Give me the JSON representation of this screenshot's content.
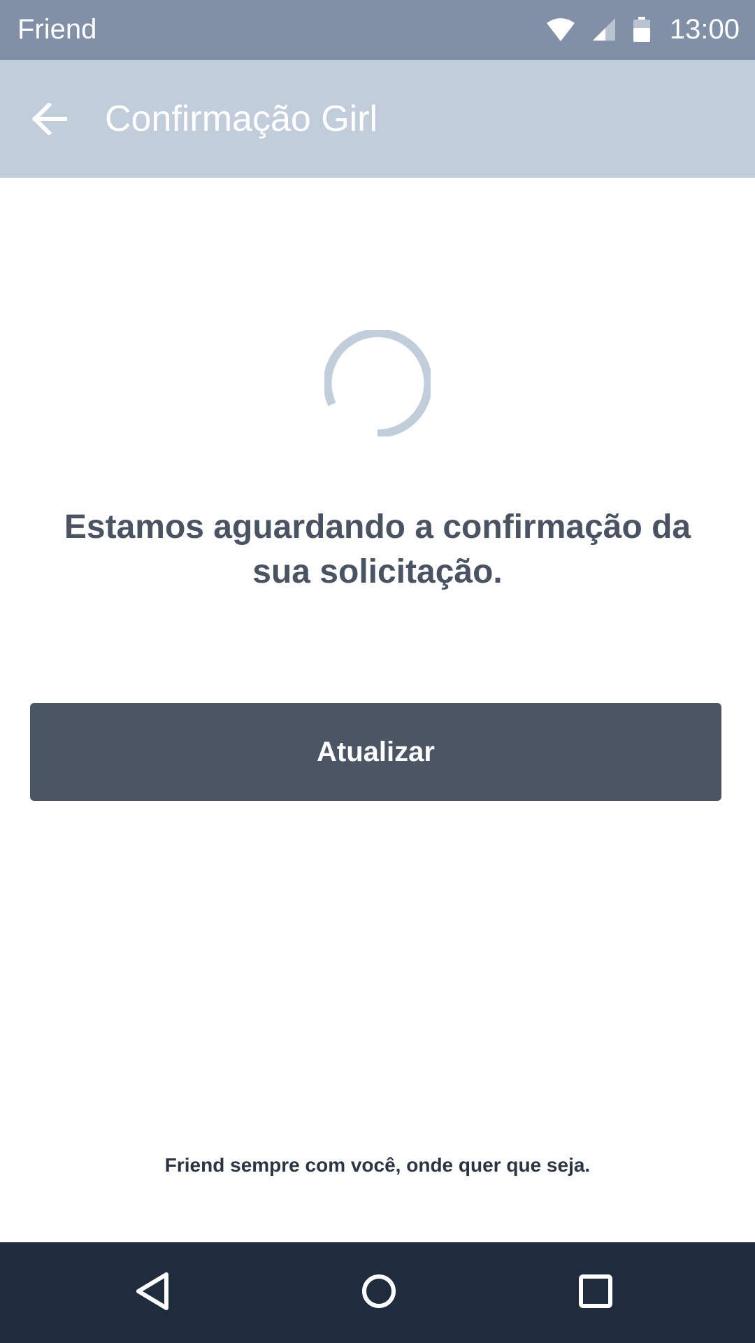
{
  "status_bar": {
    "carrier": "Friend",
    "time": "13:00",
    "icons": [
      "wifi-icon",
      "cell-signal-icon",
      "battery-icon"
    ]
  },
  "app_bar": {
    "title": "Confirmação Girl",
    "back_icon": "arrow-left-icon"
  },
  "main": {
    "spinner_icon": "loading-spinner",
    "message": "Estamos aguardando a confirmação da sua solicitação.",
    "refresh_button_label": "Atualizar"
  },
  "footer": {
    "tagline": "Friend sempre com você, onde quer que seja."
  },
  "nav_bar": {
    "icons": [
      "nav-back-icon",
      "nav-home-icon",
      "nav-recent-icon"
    ]
  },
  "colors": {
    "status_bar": "#8190a6",
    "app_bar": "#c2cddb",
    "button": "#4b5563",
    "message_text": "#4a5361",
    "nav_bar": "#1f2c3d",
    "spinner": "#c2cddb"
  }
}
